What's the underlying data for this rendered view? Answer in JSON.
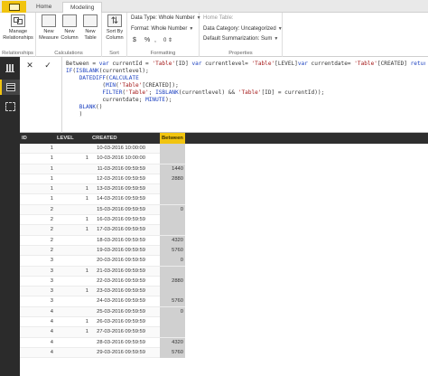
{
  "tabs": {
    "home": "Home",
    "modeling": "Modeling"
  },
  "ribbon": {
    "relationships": {
      "manage_label_1": "Manage",
      "manage_label_2": "Relationships",
      "group": "Relationships"
    },
    "calculations": {
      "new_measure_1": "New",
      "new_measure_2": "Measure",
      "new_column_1": "New",
      "new_column_2": "Column",
      "new_table_1": "New",
      "new_table_2": "Table",
      "group": "Calculations"
    },
    "sort": {
      "sort_by_1": "Sort By",
      "sort_by_2": "Column",
      "group": "Sort"
    },
    "formatting": {
      "data_type": "Data Type: Whole Number",
      "format": "Format: Whole Number",
      "currency": "$",
      "percent": "%",
      "comma": ",",
      "decimals": "0",
      "group": "Formatting"
    },
    "properties": {
      "home_table": "Home Table:",
      "data_category": "Data Category: Uncategorized",
      "default_summarization": "Default Summarization: Sum",
      "group": "Properties"
    }
  },
  "formula": {
    "cancel": "✕",
    "commit": "✓",
    "lines": [
      "Between = var currentId = 'Table'[ID] var currentlevel= 'Table'[LEVEL]var currentdate= 'Table'[CREATED] return",
      "IF(ISBLANK(currentlevel);",
      "    DATEDIFF(CALCULATE",
      "           (MIN('Table'[CREATED]);",
      "           FILTER('Table'; ISBLANK(currentlevel) && 'Table'[ID] = currentId));",
      "           currentdate; MINUTE);",
      "    BLANK()",
      "    )"
    ]
  },
  "rail": {
    "icons": [
      "report-view-icon",
      "data-view-icon",
      "relationships-view-icon"
    ]
  },
  "grid": {
    "columns": [
      "ID",
      "LEVEL",
      "CREATED",
      "Between"
    ],
    "rows": [
      {
        "id": "1",
        "level": "",
        "created": "10-03-2016 10:00:00",
        "between": ""
      },
      {
        "id": "1",
        "level": "1",
        "created": "10-03-2016 10:00:00",
        "between": ""
      },
      {
        "id": "1",
        "level": "",
        "created": "11-03-2016 09:59:59",
        "between": "1440"
      },
      {
        "id": "1",
        "level": "",
        "created": "12-03-2016 09:59:59",
        "between": "2880"
      },
      {
        "id": "1",
        "level": "1",
        "created": "13-03-2016 09:59:59",
        "between": ""
      },
      {
        "id": "1",
        "level": "1",
        "created": "14-03-2016 09:59:59",
        "between": ""
      },
      {
        "id": "2",
        "level": "",
        "created": "15-03-2016 09:59:59",
        "between": "0"
      },
      {
        "id": "2",
        "level": "1",
        "created": "16-03-2016 09:59:59",
        "between": ""
      },
      {
        "id": "2",
        "level": "1",
        "created": "17-03-2016 09:59:59",
        "between": ""
      },
      {
        "id": "2",
        "level": "",
        "created": "18-03-2016 09:59:59",
        "between": "4320"
      },
      {
        "id": "2",
        "level": "",
        "created": "19-03-2016 09:59:59",
        "between": "5760"
      },
      {
        "id": "3",
        "level": "",
        "created": "20-03-2016 09:59:59",
        "between": "0"
      },
      {
        "id": "3",
        "level": "1",
        "created": "21-03-2016 09:59:59",
        "between": ""
      },
      {
        "id": "3",
        "level": "",
        "created": "22-03-2016 09:59:59",
        "between": "2880"
      },
      {
        "id": "3",
        "level": "1",
        "created": "23-03-2016 09:59:59",
        "between": ""
      },
      {
        "id": "3",
        "level": "",
        "created": "24-03-2016 09:59:59",
        "between": "5760"
      },
      {
        "id": "4",
        "level": "",
        "created": "25-03-2016 09:59:59",
        "between": "0"
      },
      {
        "id": "4",
        "level": "1",
        "created": "26-03-2016 09:59:59",
        "between": ""
      },
      {
        "id": "4",
        "level": "1",
        "created": "27-03-2016 09:59:59",
        "between": ""
      },
      {
        "id": "4",
        "level": "",
        "created": "28-03-2016 09:59:59",
        "between": "4320"
      },
      {
        "id": "4",
        "level": "",
        "created": "29-03-2016 09:59:59",
        "between": "5760"
      }
    ]
  },
  "colors": {
    "accent": "#f1c40f",
    "rail": "#2b2b2b",
    "header": "#2e2e2e",
    "computed_column": "#d0d0d0"
  }
}
